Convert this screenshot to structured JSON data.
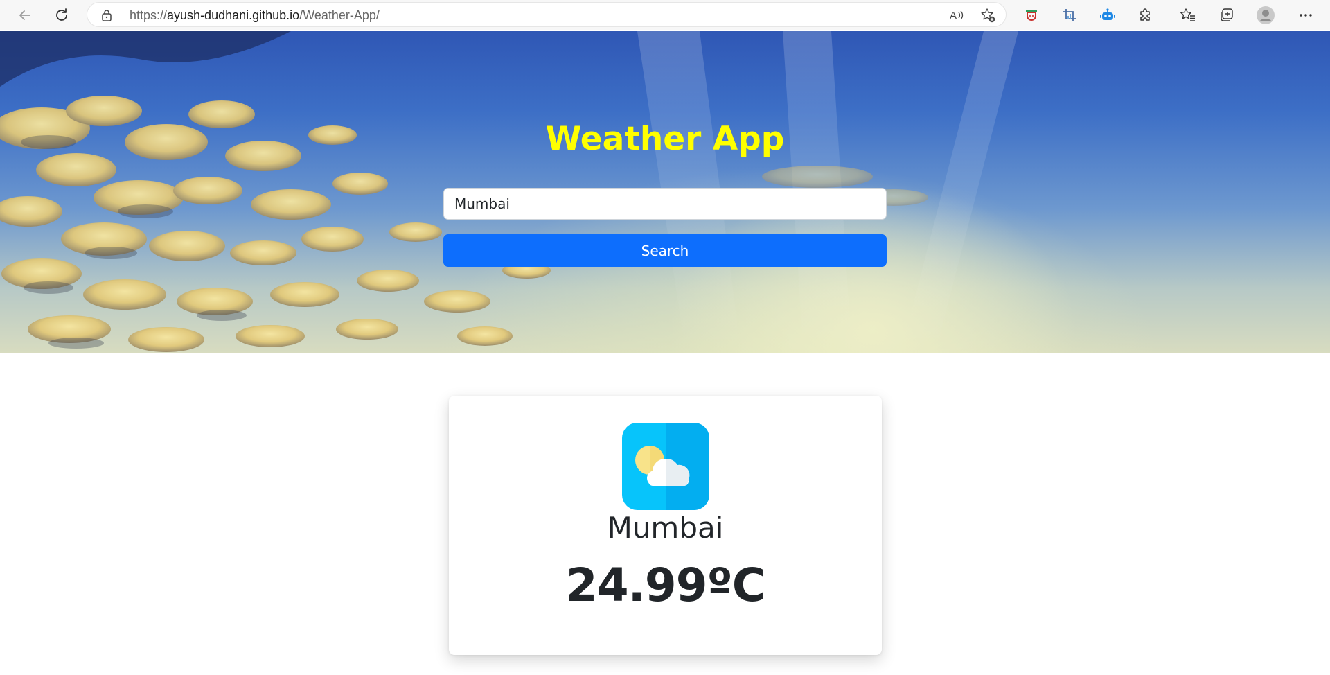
{
  "browser": {
    "url_prefix": "https://",
    "url_host": "ayush-dudhani.github.io",
    "url_path": "/Weather-App/",
    "icons": {
      "back": "back-arrow-icon",
      "reload": "reload-icon",
      "lock": "lock-icon",
      "read_aloud": "read-aloud-icon",
      "add_favorite": "add-favorite-icon",
      "extension_shield": "shield-extension-icon",
      "extension_crop": "crop-extension-icon",
      "extension_bot": "bot-extension-icon",
      "extensions": "puzzle-icon",
      "favorites": "favorites-icon",
      "collections": "collections-icon",
      "profile": "profile-avatar-icon",
      "menu": "more-menu-icon"
    }
  },
  "hero": {
    "title": "Weather App",
    "title_color": "#ffff00",
    "search_value": "Mumbai",
    "search_button_label": "Search",
    "button_color": "#0d6efd"
  },
  "result": {
    "icon": "partly-cloudy-icon",
    "city": "Mumbai",
    "temperature": "24.99ºC"
  }
}
